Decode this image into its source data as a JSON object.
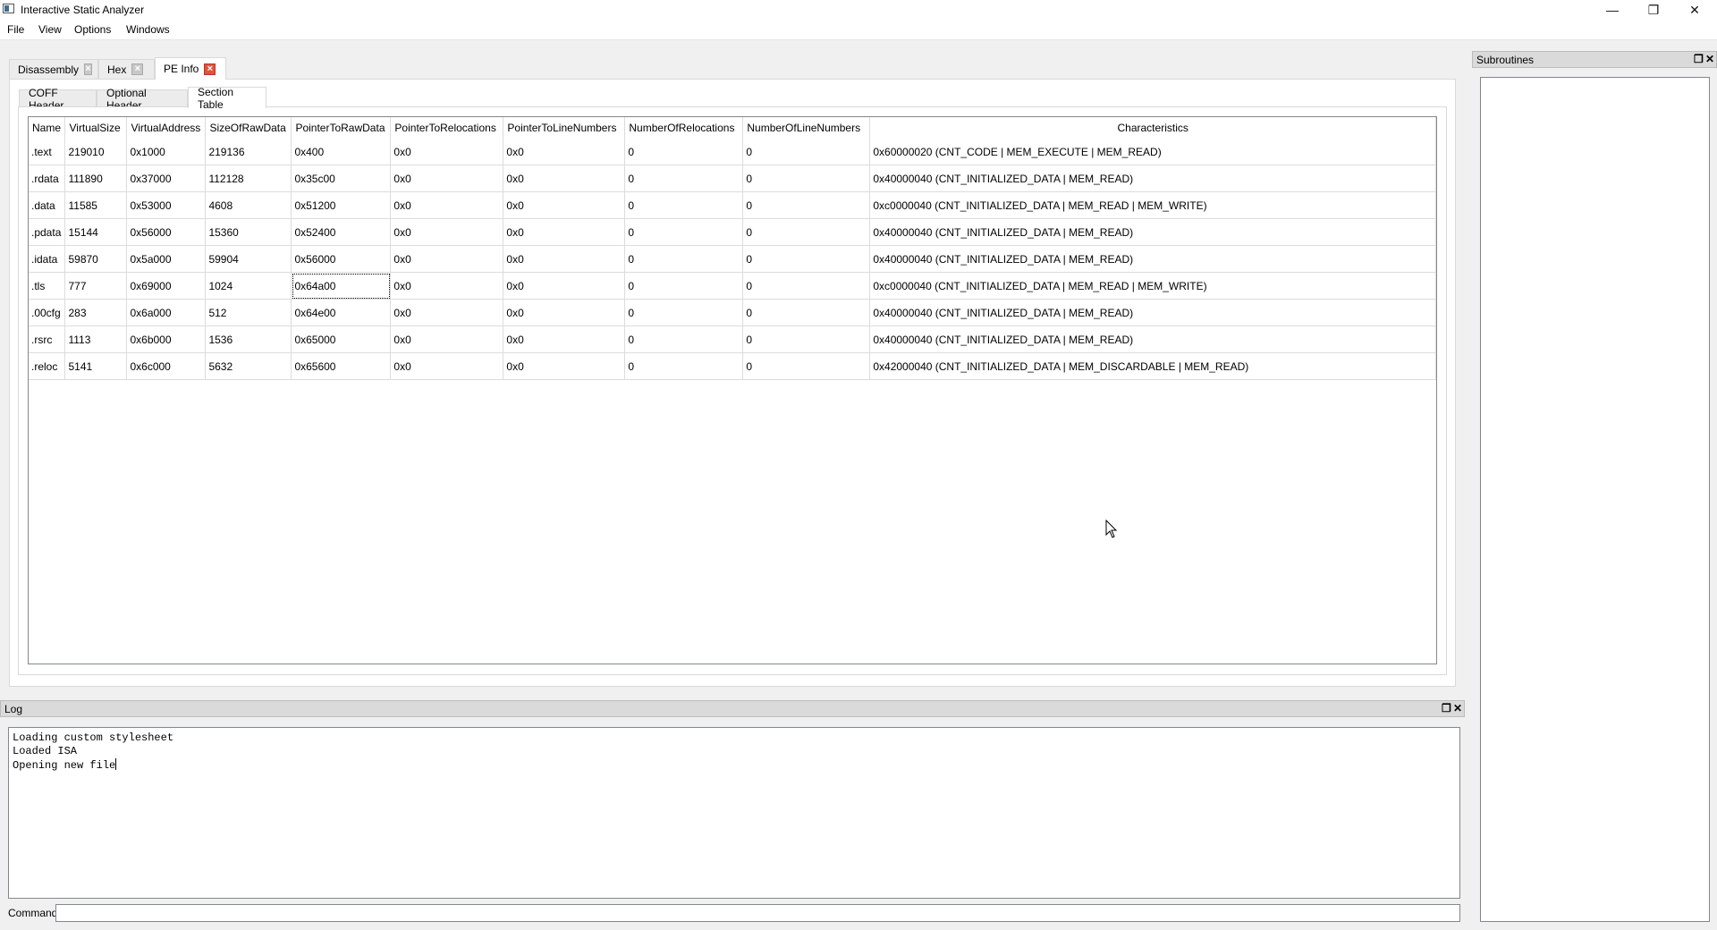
{
  "window": {
    "title": "Interactive Static Analyzer",
    "controls": {
      "minimize": "—",
      "maximize": "❐",
      "close": "✕"
    }
  },
  "menu": [
    "File",
    "View",
    "Options",
    "Windows"
  ],
  "outer_tabs": [
    {
      "label": "Disassembly",
      "active": false
    },
    {
      "label": "Hex",
      "active": false
    },
    {
      "label": "PE Info",
      "active": true
    }
  ],
  "inner_tabs": [
    {
      "label": "COFF Header",
      "active": false
    },
    {
      "label": "Optional Header",
      "active": false
    },
    {
      "label": "Section Table",
      "active": true
    }
  ],
  "section_table": {
    "columns": [
      "Name",
      "VirtualSize",
      "VirtualAddress",
      "SizeOfRawData",
      "PointerToRawData",
      "PointerToRelocations",
      "PointerToLineNumbers",
      "NumberOfRelocations",
      "NumberOfLineNumbers",
      "Characteristics"
    ],
    "rows": [
      [
        ".text",
        "219010",
        "0x1000",
        "219136",
        "0x400",
        "0x0",
        "0x0",
        "0",
        "0",
        "0x60000020 (CNT_CODE | MEM_EXECUTE | MEM_READ)"
      ],
      [
        ".rdata",
        "111890",
        "0x37000",
        "112128",
        "0x35c00",
        "0x0",
        "0x0",
        "0",
        "0",
        "0x40000040 (CNT_INITIALIZED_DATA | MEM_READ)"
      ],
      [
        ".data",
        "11585",
        "0x53000",
        "4608",
        "0x51200",
        "0x0",
        "0x0",
        "0",
        "0",
        "0xc0000040 (CNT_INITIALIZED_DATA | MEM_READ | MEM_WRITE)"
      ],
      [
        ".pdata",
        "15144",
        "0x56000",
        "15360",
        "0x52400",
        "0x0",
        "0x0",
        "0",
        "0",
        "0x40000040 (CNT_INITIALIZED_DATA | MEM_READ)"
      ],
      [
        ".idata",
        "59870",
        "0x5a000",
        "59904",
        "0x56000",
        "0x0",
        "0x0",
        "0",
        "0",
        "0x40000040 (CNT_INITIALIZED_DATA | MEM_READ)"
      ],
      [
        ".tls",
        "777",
        "0x69000",
        "1024",
        "0x64a00",
        "0x0",
        "0x0",
        "0",
        "0",
        "0xc0000040 (CNT_INITIALIZED_DATA | MEM_READ | MEM_WRITE)"
      ],
      [
        ".00cfg",
        "283",
        "0x6a000",
        "512",
        "0x64e00",
        "0x0",
        "0x0",
        "0",
        "0",
        "0x40000040 (CNT_INITIALIZED_DATA | MEM_READ)"
      ],
      [
        ".rsrc",
        "1113",
        "0x6b000",
        "1536",
        "0x65000",
        "0x0",
        "0x0",
        "0",
        "0",
        "0x40000040 (CNT_INITIALIZED_DATA | MEM_READ)"
      ],
      [
        ".reloc",
        "5141",
        "0x6c000",
        "5632",
        "0x65600",
        "0x0",
        "0x0",
        "0",
        "0",
        "0x42000040 (CNT_INITIALIZED_DATA | MEM_DISCARDABLE | MEM_READ)"
      ]
    ],
    "focused_cell": {
      "row": 5,
      "col": 4
    }
  },
  "subroutines_dock": {
    "title": "Subroutines",
    "items": []
  },
  "log_dock": {
    "title": "Log",
    "lines": [
      "Loading custom stylesheet",
      "Loaded ISA",
      "Opening new file"
    ],
    "command_label": "Command",
    "command_value": ""
  },
  "colors": {
    "active_close": "#e0533b",
    "dock_header": "#dadada",
    "background": "#f0f0f0"
  }
}
